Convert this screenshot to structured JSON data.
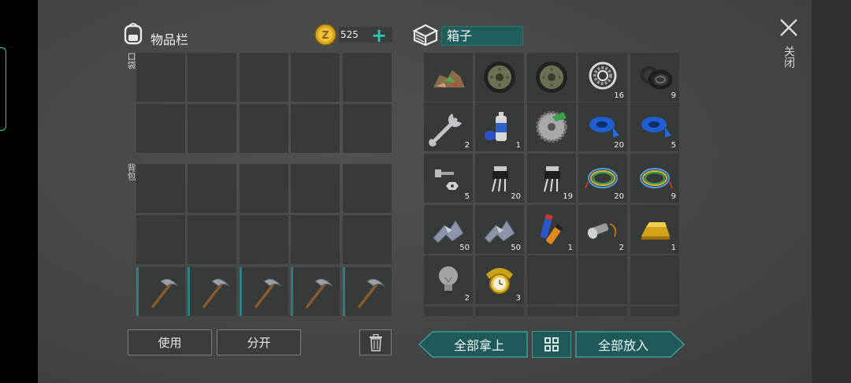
{
  "inventory": {
    "title": "物品栏",
    "pockets_label": "口袋",
    "backpack_label": "背包",
    "coins": "525"
  },
  "box": {
    "name": "箱子",
    "items": [
      {
        "qty": ""
      },
      {
        "qty": ""
      },
      {
        "qty": ""
      },
      {
        "qty": "16"
      },
      {
        "qty": "9"
      },
      {
        "qty": "2"
      },
      {
        "qty": "1"
      },
      {
        "qty": ""
      },
      {
        "qty": "20"
      },
      {
        "qty": "5"
      },
      {
        "qty": "5"
      },
      {
        "qty": "20"
      },
      {
        "qty": "19"
      },
      {
        "qty": "20"
      },
      {
        "qty": "9"
      },
      {
        "qty": "50"
      },
      {
        "qty": "50"
      },
      {
        "qty": "1"
      },
      {
        "qty": "2"
      },
      {
        "qty": "1"
      },
      {
        "qty": "2"
      },
      {
        "qty": "3"
      },
      {
        "qty": ""
      },
      {
        "qty": ""
      },
      {
        "qty": ""
      }
    ]
  },
  "buttons": {
    "use": "使用",
    "split": "分开",
    "take_all": "全部拿上",
    "put_all": "全部放入",
    "close": "关闭"
  }
}
